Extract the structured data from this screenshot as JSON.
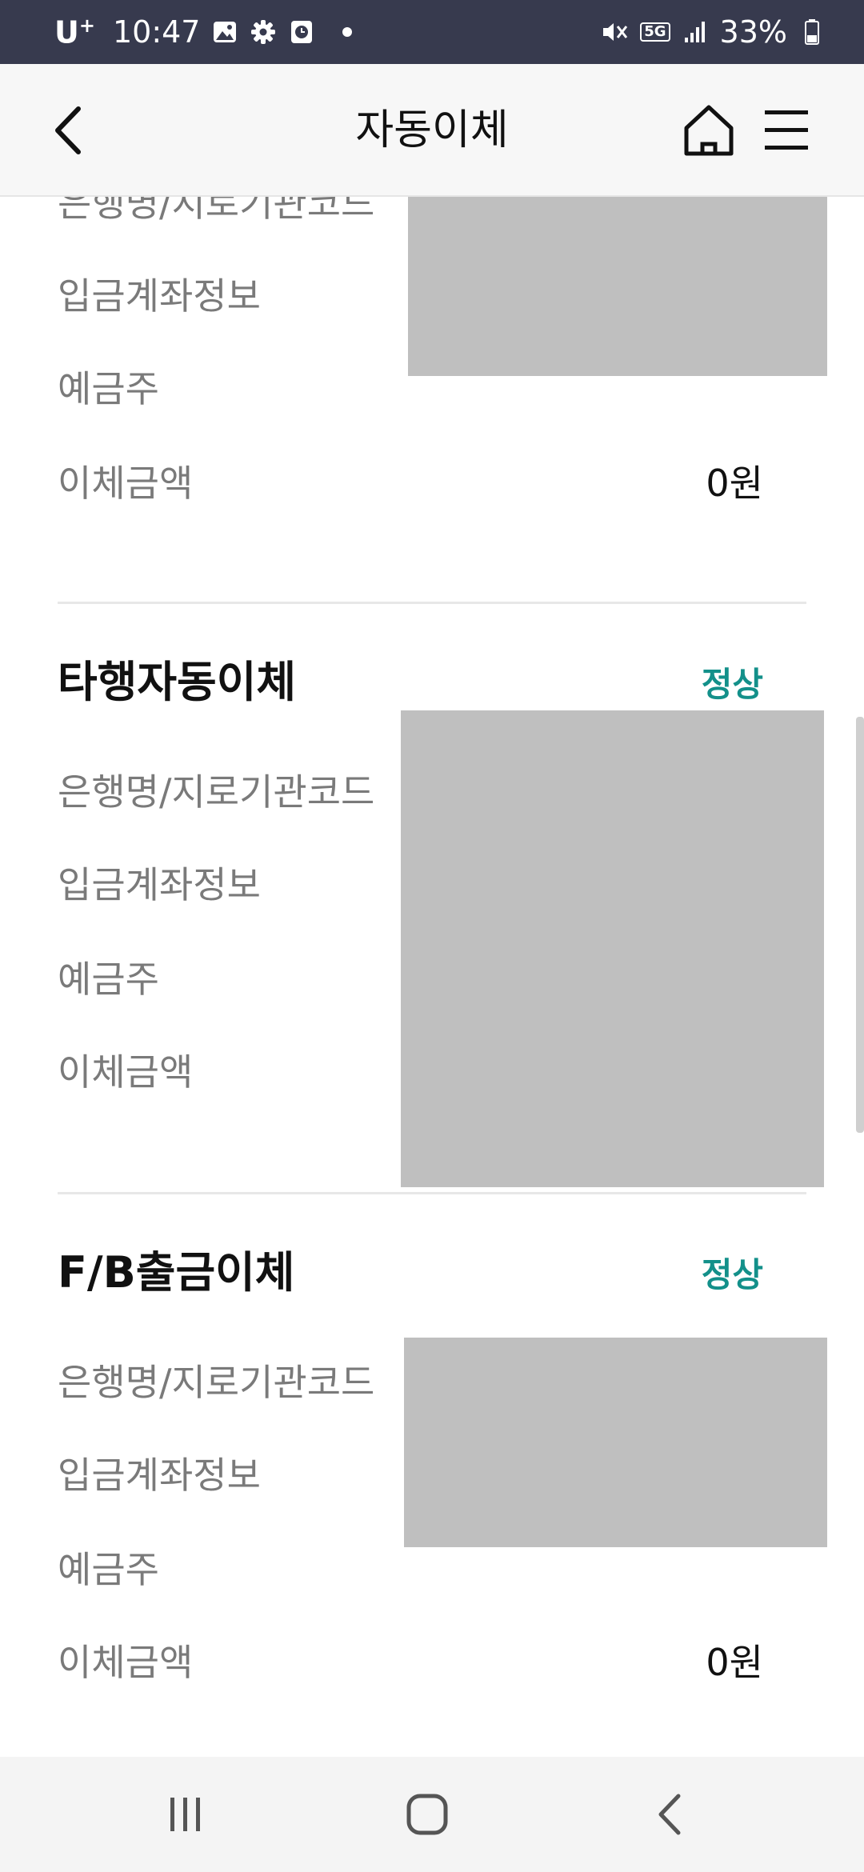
{
  "status_bar": {
    "carrier": "U",
    "carrier_sup": "+",
    "time": "10:47",
    "network": "5G",
    "battery": "33%"
  },
  "header": {
    "title": "자동이체"
  },
  "section_1": {
    "rows": [
      {
        "label": "은행명/지로기관코드",
        "value": ""
      },
      {
        "label": "입금계좌정보",
        "value": ""
      },
      {
        "label": "예금주",
        "value": ""
      },
      {
        "label": "이체금액",
        "value": "0원"
      }
    ]
  },
  "section_2": {
    "title": "타행자동이체",
    "status": "정상",
    "rows": [
      {
        "label": "은행명/지로기관코드",
        "value": ""
      },
      {
        "label": "입금계좌정보",
        "value": ""
      },
      {
        "label": "예금주",
        "value": ""
      },
      {
        "label": "이체금액",
        "value": ""
      }
    ]
  },
  "section_3": {
    "title": "F/B출금이체",
    "status": "정상",
    "rows": [
      {
        "label": "은행명/지로기관코드",
        "value": ""
      },
      {
        "label": "입금계좌정보",
        "value": ""
      },
      {
        "label": "예금주",
        "value": ""
      },
      {
        "label": "이체금액",
        "value": "0원"
      }
    ]
  },
  "colors": {
    "status_bar": "#373a4e",
    "status_ok": "#13908a",
    "redaction": "#bfbfbf"
  }
}
